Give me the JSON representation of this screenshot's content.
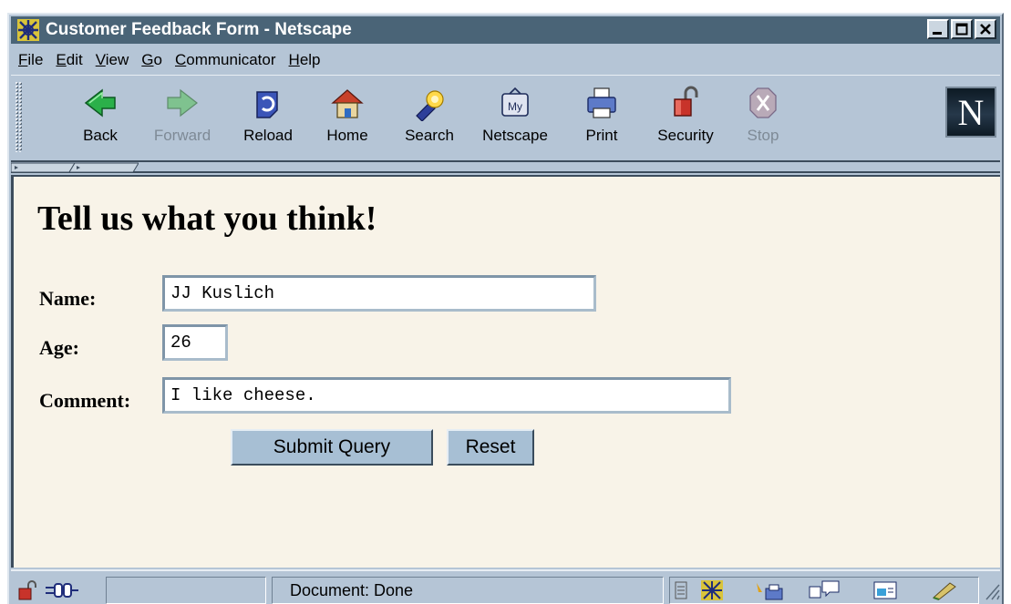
{
  "window": {
    "title": "Customer Feedback Form - Netscape"
  },
  "menu": {
    "items": [
      {
        "key": "F",
        "rest": "ile"
      },
      {
        "key": "E",
        "rest": "dit"
      },
      {
        "key": "V",
        "rest": "iew"
      },
      {
        "key": "G",
        "rest": "o"
      },
      {
        "key": "C",
        "rest": "ommunicator"
      },
      {
        "key": "H",
        "rest": "elp"
      }
    ]
  },
  "toolbar": {
    "back": "Back",
    "forward": "Forward",
    "reload": "Reload",
    "home": "Home",
    "search": "Search",
    "netscape": "Netscape",
    "print": "Print",
    "security": "Security",
    "stop": "Stop",
    "logo_letter": "N"
  },
  "page": {
    "heading": "Tell us what you think!",
    "name_label": "Name:",
    "name_value": "JJ Kuslich",
    "age_label": "Age:",
    "age_value": "26",
    "comment_label": "Comment:",
    "comment_value": "I like cheese.",
    "submit_label": "Submit Query",
    "reset_label": "Reset"
  },
  "status": {
    "text": "Document: Done"
  },
  "colors": {
    "titlebar": "#4a6477",
    "chrome": "#b5c5d6",
    "page_background": "#f8f3e8",
    "button": "#a7bfd4"
  },
  "icons": [
    "netscape-app-icon",
    "back-arrow-icon",
    "forward-arrow-icon",
    "reload-icon",
    "home-icon",
    "search-flashlight-icon",
    "my-netscape-icon",
    "printer-icon",
    "padlock-icon",
    "stop-icon",
    "netscape-n-logo",
    "status-padlock-icon",
    "offline-plug-icon",
    "status-page-icon",
    "navigator-wheel-icon",
    "mail-icon",
    "discussion-icon",
    "composer-icon",
    "pen-icon"
  ]
}
